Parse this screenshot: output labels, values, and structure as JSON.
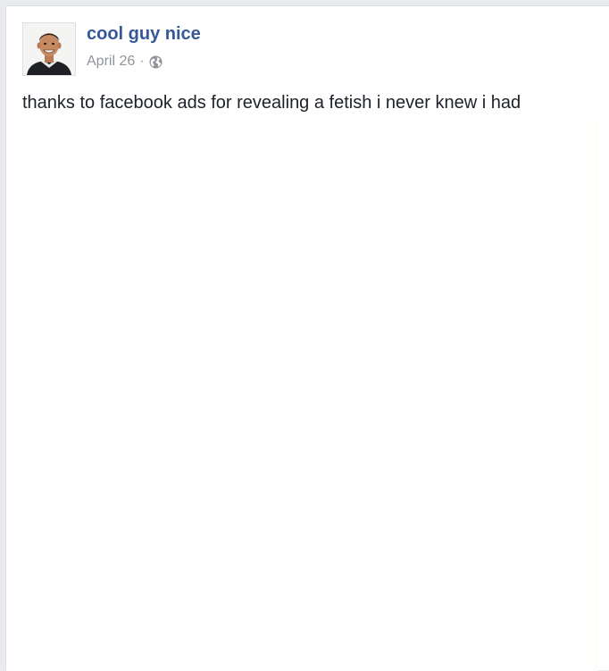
{
  "post": {
    "author": "cool guy nice",
    "date": "April 26",
    "separator": "·",
    "privacy_icon": "globe-icon",
    "text": "thanks to facebook ads for revealing a fetish i never knew i had"
  },
  "colors": {
    "author_link": "#365899",
    "meta_text": "#90949c",
    "body_text": "#1d2129",
    "page_background": "#e9ebee"
  }
}
